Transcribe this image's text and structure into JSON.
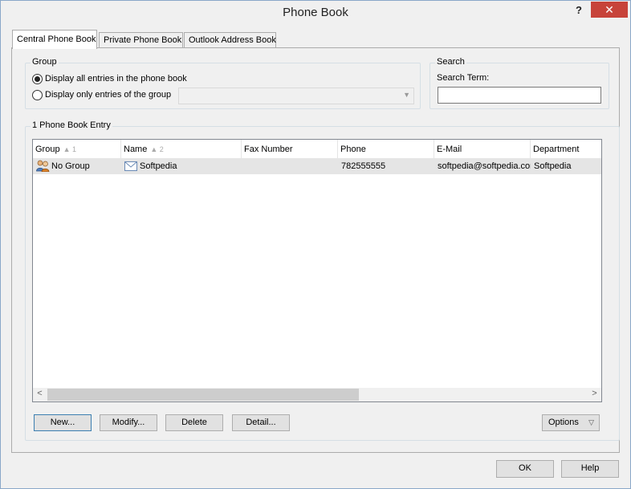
{
  "window": {
    "title": "Phone Book",
    "help_glyph": "?",
    "close_glyph": "✕"
  },
  "tabs": [
    {
      "label": "Central Phone Book",
      "active": true
    },
    {
      "label": "Private Phone Book",
      "active": false
    },
    {
      "label": "Outlook Address Book",
      "active": false
    }
  ],
  "group": {
    "legend": "Group",
    "option_all": "Display all entries in the phone book",
    "option_group": "Display only entries of the group",
    "selected": "all",
    "combo_value": ""
  },
  "search": {
    "legend": "Search",
    "term_label": "Search Term:",
    "term_value": ""
  },
  "entries": {
    "legend": "1 Phone Book Entry",
    "columns": [
      {
        "label": "Group",
        "sort": "▲ 1"
      },
      {
        "label": "Name",
        "sort": "▲ 2"
      },
      {
        "label": "Fax Number",
        "sort": ""
      },
      {
        "label": "Phone",
        "sort": ""
      },
      {
        "label": "E-Mail",
        "sort": ""
      },
      {
        "label": "Department",
        "sort": ""
      }
    ],
    "rows": [
      {
        "group": "No Group",
        "name": "Softpedia",
        "fax": "",
        "phone": "782555555",
        "email": "softpedia@softpedia.com",
        "department": "Softpedia"
      }
    ],
    "scroll_left": "<",
    "scroll_right": ">"
  },
  "actions": {
    "new": "New...",
    "modify": "Modify...",
    "delete": "Delete",
    "detail": "Detail...",
    "options": "Options",
    "options_arrow": "▽"
  },
  "footer": {
    "ok": "OK",
    "help": "Help"
  }
}
